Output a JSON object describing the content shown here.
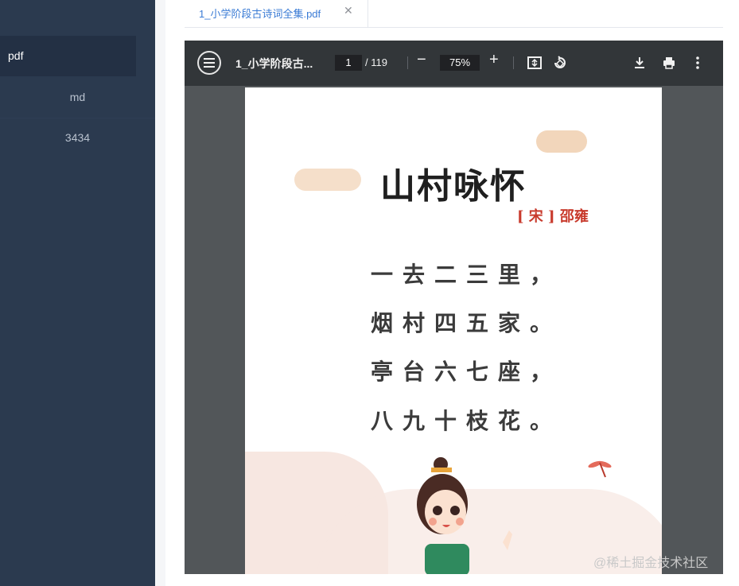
{
  "sidebar": {
    "items": [
      {
        "label": "pdf"
      },
      {
        "label": "md"
      },
      {
        "label": "3434"
      }
    ]
  },
  "tabs": [
    {
      "label": "1_小学阶段古诗词全集.pdf"
    }
  ],
  "pdf_toolbar": {
    "title": "1_小学阶段古...",
    "page_current": "1",
    "page_total": "/ 119",
    "zoom": "75%"
  },
  "pdf_page": {
    "title": "山村咏怀",
    "author": "[ 宋 ] 邵雍",
    "lines": [
      "一去二三里，",
      "烟村四五家。",
      "亭台六七座，",
      "八九十枝花。"
    ]
  },
  "watermark": "@稀土掘金技术社区",
  "icons": {
    "menu": "menu-icon",
    "close": "close-icon",
    "fit": "fit-page-icon",
    "rotate": "rotate-icon",
    "download": "download-icon",
    "print": "print-icon",
    "more": "more-vert-icon"
  },
  "colors": {
    "sidebar_bg": "#2b3a4f",
    "tab_active": "#3a7bd5",
    "toolbar_bg": "#323639",
    "author_red": "#c83a2c"
  }
}
